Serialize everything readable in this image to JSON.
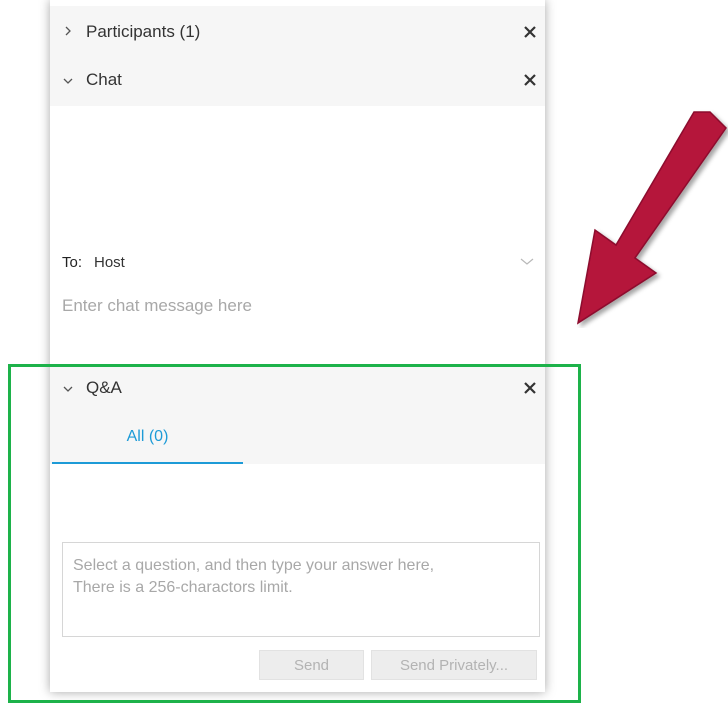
{
  "participants": {
    "title": "Participants (1)",
    "chevron": "chevron-right-icon",
    "close": "close-icon"
  },
  "chat": {
    "title": "Chat",
    "chevron": "chevron-down-icon",
    "close": "close-icon",
    "to_label": "To:",
    "to_value": "Host",
    "input_placeholder": "Enter chat message here"
  },
  "qa": {
    "title": "Q&A",
    "chevron": "chevron-down-icon",
    "close": "close-icon",
    "tabs": [
      {
        "label": "All (0)",
        "active": true
      }
    ],
    "answer_placeholder": "Select a question, and then type your answer here,\nThere is a 256-charactors limit.",
    "send_label": "Send",
    "send_privately_label": "Send Privately..."
  },
  "colors": {
    "accent": "#1d9bd7",
    "highlight_box": "#1db24a",
    "arrow": "#b5123a",
    "header_bg": "#f6f6f6"
  }
}
